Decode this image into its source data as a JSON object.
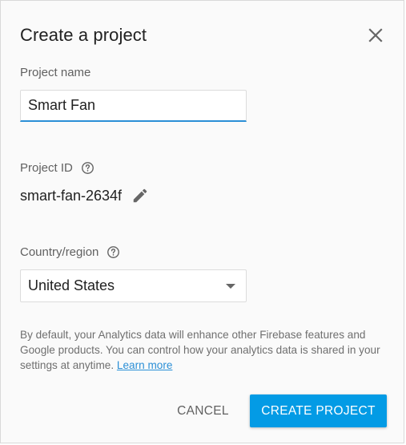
{
  "dialog": {
    "title": "Create a project",
    "close_icon": "close-icon"
  },
  "project_name": {
    "label": "Project name",
    "value": "Smart Fan"
  },
  "project_id": {
    "label": "Project ID",
    "help_icon": "help-circle-icon",
    "value": "smart-fan-2634f",
    "edit_icon": "pencil-icon"
  },
  "country": {
    "label": "Country/region",
    "help_icon": "help-circle-icon",
    "selected": "United States",
    "dropdown_icon": "caret-down-icon"
  },
  "disclaimer": {
    "text": "By default, your Analytics data will enhance other Firebase features and Google products. You can control how your analytics data is shared in your settings at anytime.",
    "link": "Learn more"
  },
  "actions": {
    "cancel_label": "CANCEL",
    "create_label": "CREATE PROJECT"
  },
  "colors": {
    "accent": "#039be5",
    "input_underline": "#2b8fd6",
    "link": "#2b8fd6",
    "dialog_bg": "#fafafa"
  }
}
